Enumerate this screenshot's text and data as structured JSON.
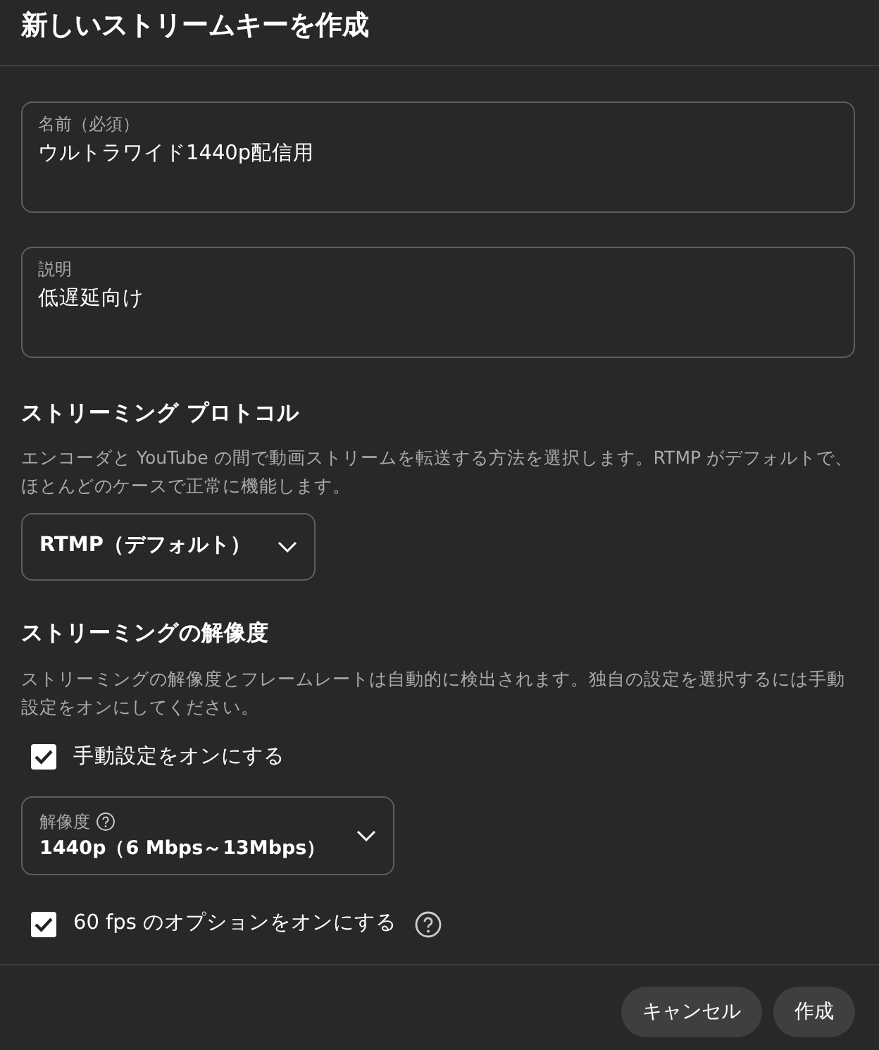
{
  "dialog": {
    "title": "新しいストリームキーを作成"
  },
  "fields": [
    {
      "label": "名前（必須）",
      "value": "ウルトラワイド1440p配信用"
    },
    {
      "label": "説明",
      "value": "低遅延向け"
    }
  ],
  "protocol": {
    "heading": "ストリーミング プロトコル",
    "description": "エンコーダと YouTube の間で動画ストリームを転送する方法を選択します。RTMP がデフォルトで、ほとんどのケースで正常に機能します。",
    "select": {
      "value": "RTMP（デフォルト）"
    }
  },
  "resolution": {
    "heading": "ストリーミングの解像度",
    "description": "ストリーミングの解像度とフレームレートは自動的に検出されます。独自の設定を選択するには手動設定をオンにしてください。",
    "manual": {
      "label": "手動設定をオンにする",
      "checked": true
    },
    "select": {
      "label": "解像度",
      "value": "1440p（6 Mbps～13Mbps）"
    },
    "fps": {
      "label": "60 fps のオプションをオンにする",
      "checked": true
    }
  },
  "buttons": [
    {
      "label": "キャンセル"
    },
    {
      "label": "作成"
    }
  ]
}
